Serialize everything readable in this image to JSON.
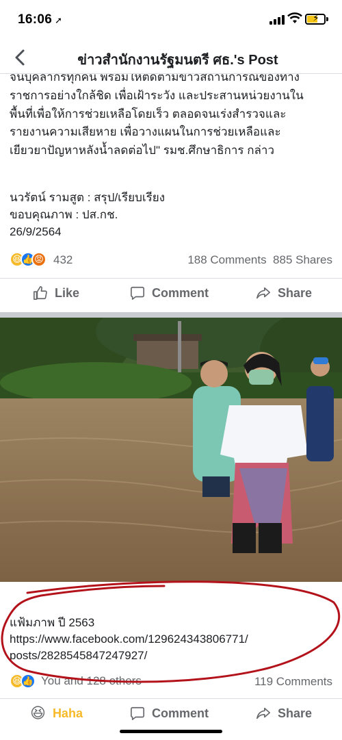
{
  "status_bar": {
    "time": "16:06",
    "nav_arrow": "➚"
  },
  "header": {
    "back_icon": "chevron-left-icon",
    "title": "ข่าวสำนักงานรัฐมนตรี ศธ.'s Post"
  },
  "post": {
    "body": "จนบุคลากรทุกคน พร้อมให้ติดตามข่าวสถานการณ์ของทาง\nราชการอย่างใกล้ชิด เพื่อเฝ้าระวัง และประสานหน่วยงานใน\nพื้นที่เพื่อให้การช่วยเหลือโดยเร็ว ตลอดจนเร่งสำรวจและ\nรายงานความเสียหาย เพื่อวางแผนในการช่วยเหลือและ\nเยียวยาปัญหาหลังน้ำลดต่อไป\" รมช.ศึกษาธิการ กล่าว",
    "byline_1": "นวรัตน์ รามสูต : สรุป/เรียบเรียง",
    "byline_2": "ขอบคุณภาพ : ปส.กช.",
    "byline_3": "26/9/2564",
    "reaction_count": "432",
    "comments": "188 Comments",
    "shares": "885 Shares",
    "actions": {
      "like": "Like",
      "comment": "Comment",
      "share": "Share"
    }
  },
  "shared_card": {
    "caption_1": "แฟ้มภาพ ปี 2563",
    "link_1": "https://www.facebook.com/129624343806771/",
    "link_2": "posts/2828545847247927/",
    "you_and_others": "You and 128 others",
    "comments": "119 Comments",
    "actions": {
      "haha": "Haha",
      "comment": "Comment",
      "share": "Share"
    }
  },
  "colors": {
    "facebook_blue": "#1877f2",
    "haha_yellow": "#f7b928",
    "annotation_red": "#b3121b",
    "secondary_text": "#65676b"
  }
}
